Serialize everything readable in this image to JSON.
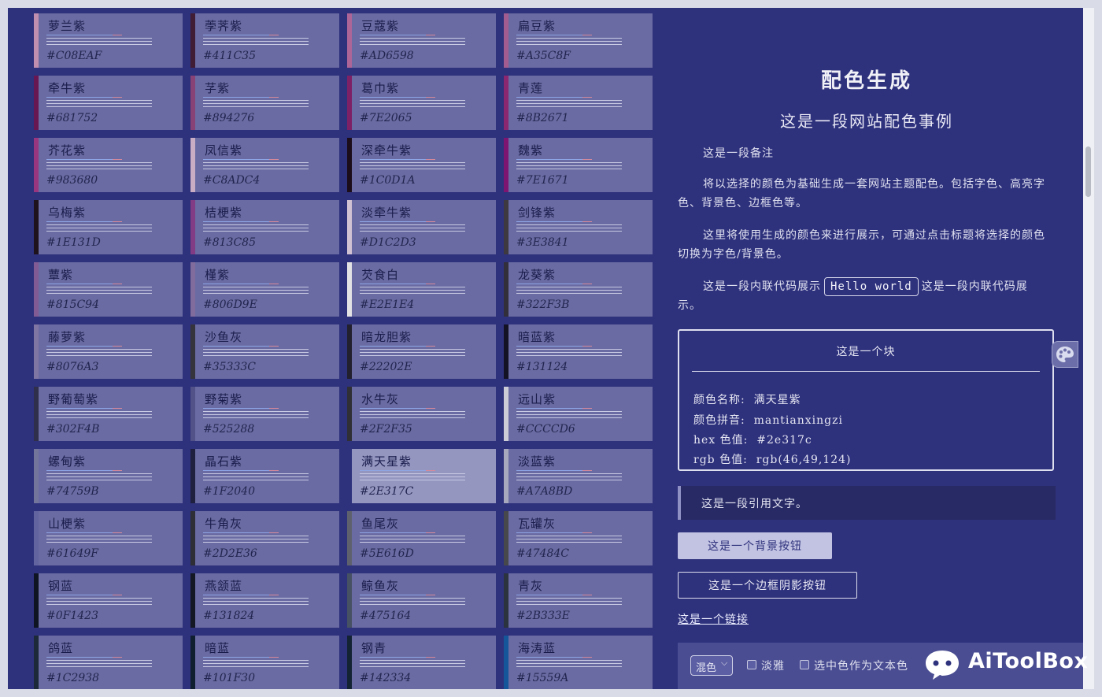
{
  "colors": [
    {
      "name": "萝兰紫",
      "hex": "#C08EAF"
    },
    {
      "name": "荸荠紫",
      "hex": "#411C35"
    },
    {
      "name": "豆蔻紫",
      "hex": "#AD6598"
    },
    {
      "name": "扁豆紫",
      "hex": "#A35C8F"
    },
    {
      "name": "牵牛紫",
      "hex": "#681752"
    },
    {
      "name": "芓紫",
      "hex": "#894276"
    },
    {
      "name": "葛巾紫",
      "hex": "#7E2065"
    },
    {
      "name": "青莲",
      "hex": "#8B2671"
    },
    {
      "name": "芥花紫",
      "hex": "#983680"
    },
    {
      "name": "凤信紫",
      "hex": "#C8ADC4"
    },
    {
      "name": "深牵牛紫",
      "hex": "#1C0D1A"
    },
    {
      "name": "魏紫",
      "hex": "#7E1671"
    },
    {
      "name": "乌梅紫",
      "hex": "#1E131D"
    },
    {
      "name": "桔梗紫",
      "hex": "#813C85"
    },
    {
      "name": "淡牵牛紫",
      "hex": "#D1C2D3"
    },
    {
      "name": "剑锋紫",
      "hex": "#3E3841"
    },
    {
      "name": "蕈紫",
      "hex": "#815C94"
    },
    {
      "name": "槿紫",
      "hex": "#806D9E"
    },
    {
      "name": "芡食白",
      "hex": "#E2E1E4"
    },
    {
      "name": "龙葵紫",
      "hex": "#322F3B"
    },
    {
      "name": "藤萝紫",
      "hex": "#8076A3"
    },
    {
      "name": "沙鱼灰",
      "hex": "#35333C"
    },
    {
      "name": "暗龙胆紫",
      "hex": "#22202E"
    },
    {
      "name": "暗蓝紫",
      "hex": "#131124"
    },
    {
      "name": "野葡萄紫",
      "hex": "#302F4B"
    },
    {
      "name": "野菊紫",
      "hex": "#525288"
    },
    {
      "name": "水牛灰",
      "hex": "#2F2F35"
    },
    {
      "name": "远山紫",
      "hex": "#CCCCD6"
    },
    {
      "name": "螺甸紫",
      "hex": "#74759B"
    },
    {
      "name": "晶石紫",
      "hex": "#1F2040"
    },
    {
      "name": "满天星紫",
      "hex": "#2E317C"
    },
    {
      "name": "淡蓝紫",
      "hex": "#A7A8BD"
    },
    {
      "name": "山梗紫",
      "hex": "#61649F"
    },
    {
      "name": "牛角灰",
      "hex": "#2D2E36"
    },
    {
      "name": "鱼尾灰",
      "hex": "#5E616D"
    },
    {
      "name": "瓦罐灰",
      "hex": "#47484C"
    },
    {
      "name": "钢蓝",
      "hex": "#0F1423"
    },
    {
      "name": "燕颔蓝",
      "hex": "#131824"
    },
    {
      "name": "鲸鱼灰",
      "hex": "#475164"
    },
    {
      "name": "青灰",
      "hex": "#2B333E"
    },
    {
      "name": "鸽蓝",
      "hex": "#1C2938"
    },
    {
      "name": "暗蓝",
      "hex": "#101F30"
    },
    {
      "name": "钢青",
      "hex": "#142334"
    },
    {
      "name": "海涛蓝",
      "hex": "#15559A"
    }
  ],
  "selected_index": 30,
  "panel": {
    "title": "配色生成",
    "subtitle": "这是一段网站配色事例",
    "note": "这是一段备注",
    "para1": "将以选择的颜色为基础生成一套网站主题配色。包括字色、高亮字色、背景色、边框色等。",
    "para2": "这里将使用生成的颜色来进行展示，可通过点击标题将选择的颜色切换为字色/背景色。",
    "inline_before": "这是一段内联代码展示",
    "inline_code": "Hello world",
    "inline_after": "这是一段内联代码展示。",
    "block": {
      "title": "这是一个块",
      "name_label": "颜色名称:",
      "name_value": "满天星紫",
      "pinyin_label": "颜色拼音:",
      "pinyin_value": "mantianxingzi",
      "hex_label": "hex  色值:",
      "hex_value": "#2e317c",
      "rgb_label": "rgb  色值:",
      "rgb_value": "rgb(46,49,124)"
    },
    "quote": "这是一段引用文字。",
    "bg_button": "这是一个背景按钮",
    "border_button": "这是一个边框阴影按钮",
    "link": "这是一个链接"
  },
  "bottom_bar": {
    "select_value": "混色",
    "checkbox1": "淡雅",
    "checkbox2": "选中色作为文本色"
  },
  "watermark": "AiToolBox",
  "theme": {
    "background": "#2e317c",
    "card": "#6a6ba2",
    "card_selected": "#9496c0",
    "text": "#e5e6f2"
  }
}
